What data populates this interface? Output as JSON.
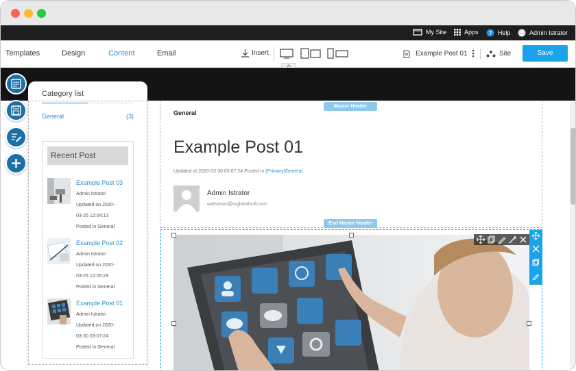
{
  "window": {
    "dots": [
      "#fe5f57",
      "#febc2e",
      "#28c840"
    ]
  },
  "topbar": {
    "my_site": "My Site",
    "apps": "Apps",
    "help": "Help",
    "user": "Admin Istrator"
  },
  "toolbar": {
    "tabs": [
      "Templates",
      "Design",
      "Content",
      "Email"
    ],
    "active_tab": "Content",
    "insert": "Insert",
    "page_name": "Example Post 01",
    "site": "Site",
    "save": "Save"
  },
  "sidebar": {
    "category_title": "Category list",
    "categories": [
      {
        "name": "General",
        "count": "(3)"
      }
    ],
    "recent_title": "Recent Post",
    "posts": [
      {
        "title": "Example Post 03",
        "author": "Admin Istrator",
        "updated_1": "Updated on 2020-",
        "updated_2": "03-25 12:04:13",
        "posted": "Posted in General"
      },
      {
        "title": "Example Post 02",
        "author": "Admin Istrator",
        "updated_1": "Updated on 2020-",
        "updated_2": "03-25 12:05:29",
        "posted": "Posted in General"
      },
      {
        "title": "Example Post 01",
        "author": "Admin Istrator",
        "updated_1": "Updated on 2020-",
        "updated_2": "03-30 03:07:24",
        "posted": "Posted in General"
      }
    ]
  },
  "content": {
    "master_header": "Master Header",
    "end_master_header": "End Master Header",
    "category": "General",
    "title": "Example Post 01",
    "meta_prefix": "Updated at 2020-03-30 03:07:24 Posted in",
    "meta_link": "(Primary)General,",
    "author_name": "Admin Istrator",
    "author_email": "watsanan@rvglobalsoft.com"
  },
  "colors": {
    "accent": "#1aa3e8",
    "link": "#2a8fc9",
    "dark": "#1e1e1e"
  }
}
